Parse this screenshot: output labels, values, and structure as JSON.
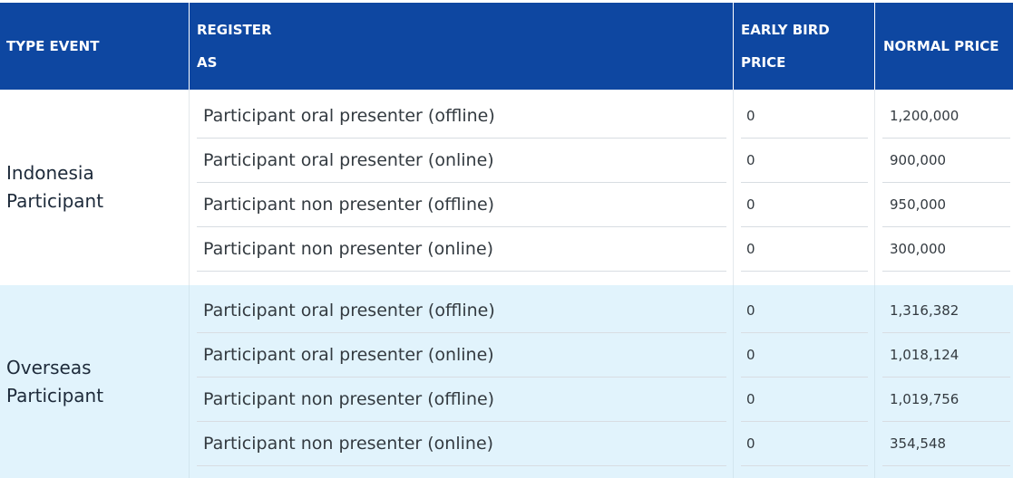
{
  "header": {
    "type_event": "TYPE EVENT",
    "register_as": "REGISTER AS",
    "early_bird_price": "EARLY BIRD PRICE",
    "normal_price": "NORMAL PRICE"
  },
  "groups": [
    {
      "type_event": "Indonesia Participant",
      "rows": [
        {
          "register_as": "Participant oral presenter (offline)",
          "early_bird": "0",
          "normal": "1,200,000"
        },
        {
          "register_as": "Participant oral presenter (online)",
          "early_bird": "0",
          "normal": "900,000"
        },
        {
          "register_as": "Participant non presenter (offline)",
          "early_bird": "0",
          "normal": "950,000"
        },
        {
          "register_as": "Participant non presenter (online)",
          "early_bird": "0",
          "normal": "300,000"
        }
      ]
    },
    {
      "type_event": "Overseas Participant",
      "rows": [
        {
          "register_as": "Participant oral presenter (offline)",
          "early_bird": "0",
          "normal": "1,316,382"
        },
        {
          "register_as": "Participant oral presenter (online)",
          "early_bird": "0",
          "normal": "1,018,124"
        },
        {
          "register_as": "Participant non presenter (offline)",
          "early_bird": "0",
          "normal": "1,019,756"
        },
        {
          "register_as": "Participant non presenter (online)",
          "early_bird": "0",
          "normal": "354,548"
        }
      ]
    }
  ],
  "colors": {
    "header_bg": "#0e47a1",
    "overseas_bg": "#e1f3fc"
  }
}
